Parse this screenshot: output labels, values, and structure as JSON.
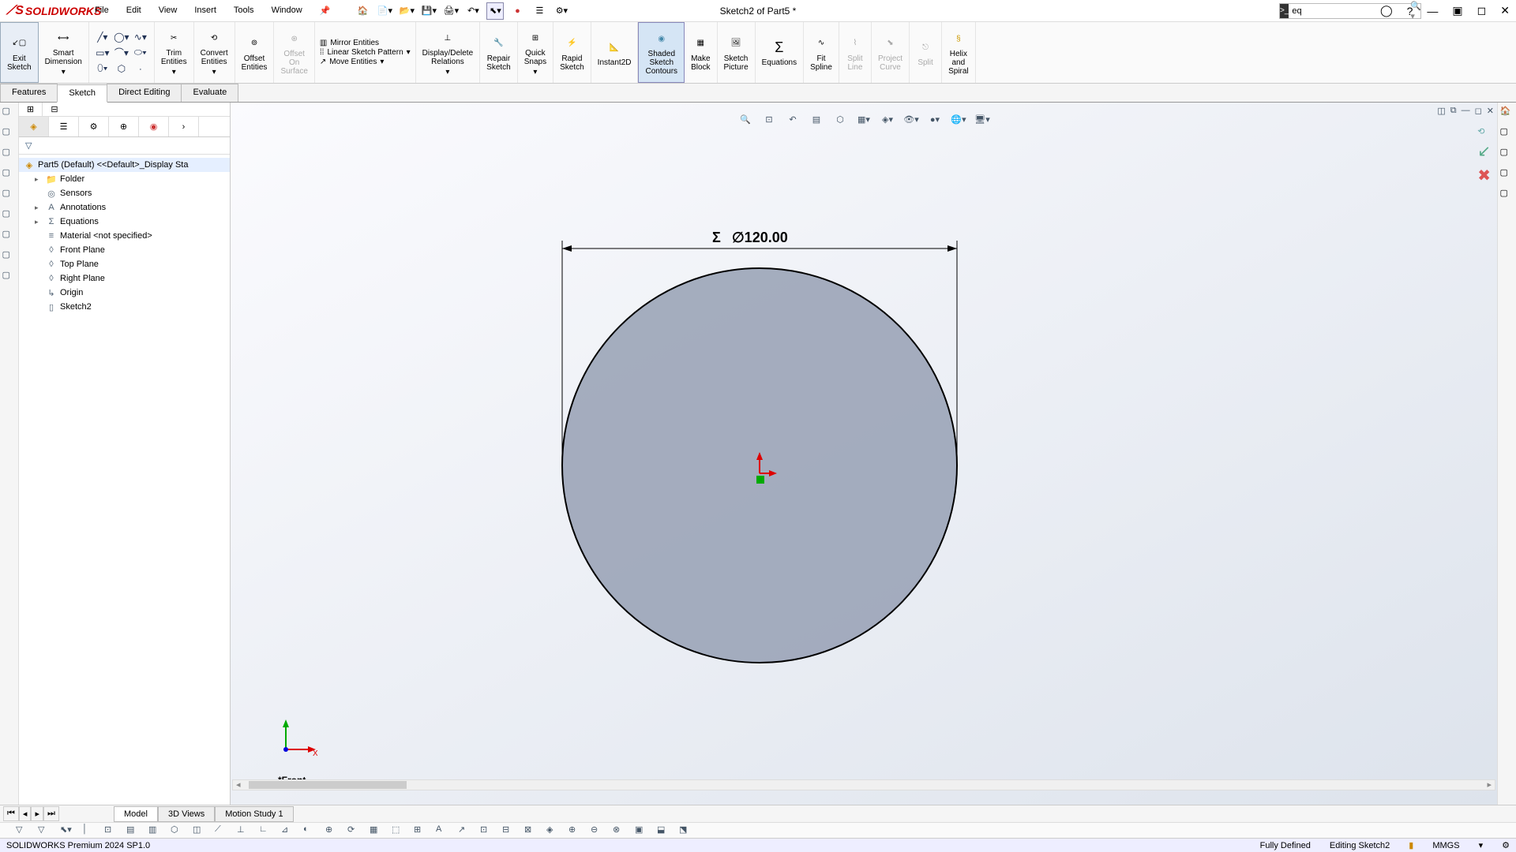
{
  "app_name": "SOLIDWORKS",
  "menu": [
    "File",
    "Edit",
    "View",
    "Insert",
    "Tools",
    "Window"
  ],
  "document_title": "Sketch2 of Part5 *",
  "search_value": "eq",
  "ribbon": {
    "exit_sketch": "Exit\nSketch",
    "smart_dim": "Smart\nDimension",
    "trim": "Trim\nEntities",
    "convert": "Convert\nEntities",
    "offset": "Offset\nEntities",
    "offset_surf": "Offset\nOn\nSurface",
    "mirror": "Mirror Entities",
    "linear_pat": "Linear Sketch Pattern",
    "move": "Move Entities",
    "disp_del": "Display/Delete\nRelations",
    "repair": "Repair\nSketch",
    "quick": "Quick\nSnaps",
    "rapid": "Rapid\nSketch",
    "instant": "Instant2D",
    "shaded": "Shaded\nSketch\nContours",
    "make_block": "Make\nBlock",
    "sketch_pic": "Sketch\nPicture",
    "equations": "Equations",
    "fit_spline": "Fit\nSpline",
    "split_line": "Split\nLine",
    "project_curve": "Project\nCurve",
    "split": "Split",
    "helix": "Helix\nand\nSpiral"
  },
  "tabs": [
    "Features",
    "Sketch",
    "Direct Editing",
    "Evaluate"
  ],
  "active_tab": "Sketch",
  "tree": {
    "root": "Part5 (Default) <<Default>_Display Sta",
    "items": [
      {
        "label": "Folder",
        "exp": true
      },
      {
        "label": "Sensors",
        "exp": false
      },
      {
        "label": "Annotations",
        "exp": true
      },
      {
        "label": "Equations",
        "exp": true
      },
      {
        "label": "Material <not specified>",
        "exp": false
      },
      {
        "label": "Front Plane",
        "exp": false
      },
      {
        "label": "Top Plane",
        "exp": false
      },
      {
        "label": "Right Plane",
        "exp": false
      },
      {
        "label": "Origin",
        "exp": false
      },
      {
        "label": "Sketch2",
        "exp": false
      }
    ]
  },
  "dimension_text": "∅120.00",
  "view_name": "*Front",
  "bottom_tabs": [
    "Model",
    "3D Views",
    "Motion Study 1"
  ],
  "status": {
    "left": "SOLIDWORKS Premium 2024 SP1.0",
    "defined": "Fully Defined",
    "mode": "Editing Sketch2",
    "units": "MMGS"
  }
}
